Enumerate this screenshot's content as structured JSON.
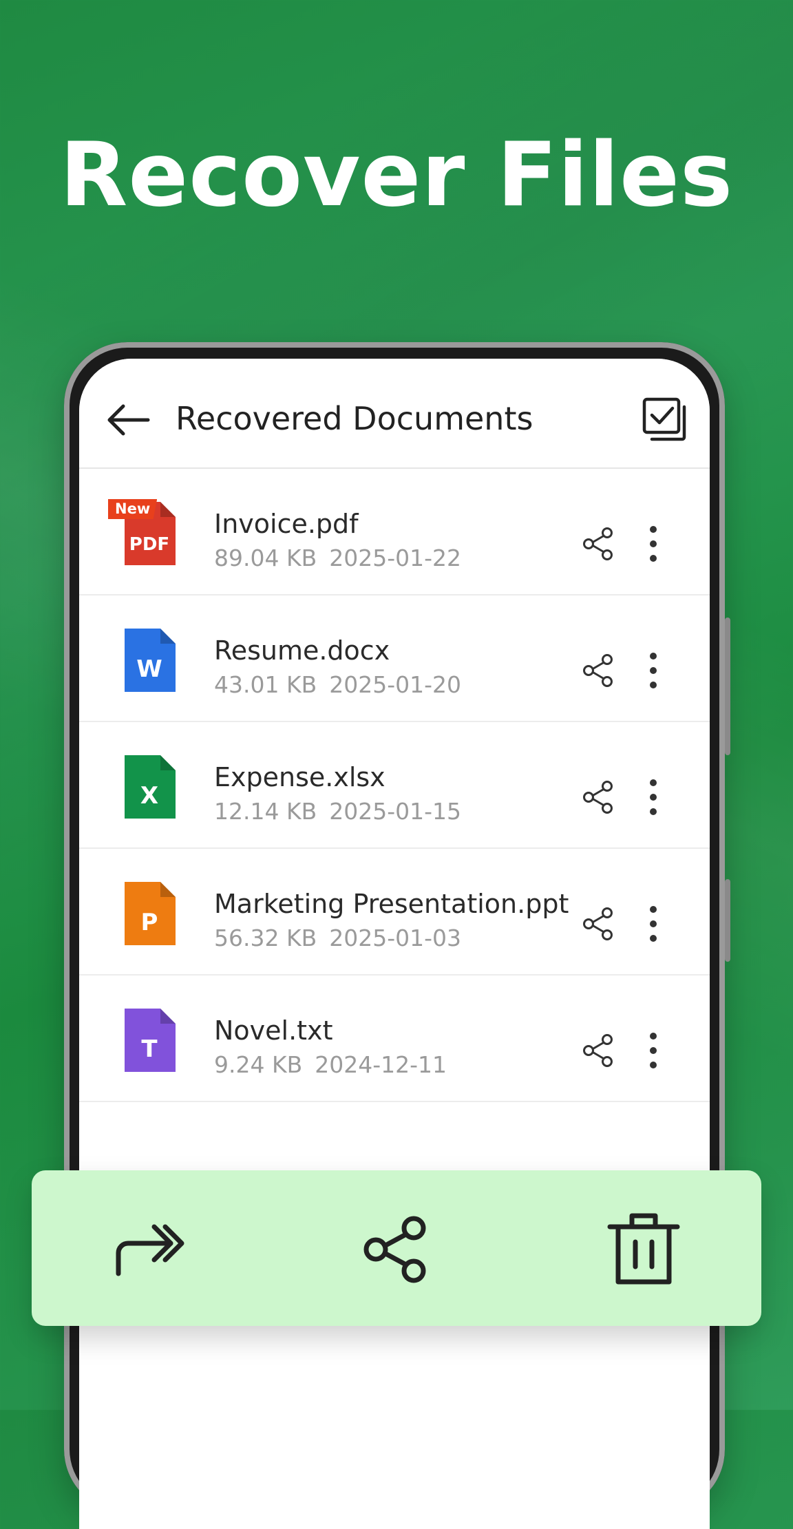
{
  "headline": "Recover Files",
  "app": {
    "title": "Recovered Documents",
    "back_icon": "arrow-left-icon",
    "select_icon": "select-all-icon"
  },
  "files": [
    {
      "name": "Invoice.pdf",
      "size": "89.04 KB",
      "date": "2025-01-22",
      "type": "PDF",
      "badge": "New",
      "color": "#d93a2b",
      "icon": "pdf-file-icon"
    },
    {
      "name": "Resume.docx",
      "size": "43.01 KB",
      "date": "2025-01-20",
      "type": "W",
      "color": "#2a72e3",
      "icon": "word-file-icon"
    },
    {
      "name": "Expense.xlsx",
      "size": "12.14 KB",
      "date": "2025-01-15",
      "type": "X",
      "color": "#12934a",
      "icon": "excel-file-icon"
    },
    {
      "name": "Marketing Presentation.ppt",
      "size": "56.32 KB",
      "date": "2025-01-03",
      "type": "P",
      "color": "#ee7c11",
      "icon": "powerpoint-file-icon"
    },
    {
      "name": "Novel.txt",
      "size": "9.24 KB",
      "date": "2024-12-11",
      "type": "T",
      "color": "#8152db",
      "icon": "text-file-icon"
    }
  ],
  "row_icons": {
    "share": "share-icon",
    "more": "more-vertical-icon"
  },
  "action_bar": {
    "background": "#cdf7cd",
    "items": [
      {
        "icon": "move-forward-icon"
      },
      {
        "icon": "share-icon"
      },
      {
        "icon": "trash-icon"
      }
    ]
  },
  "colors": {
    "brand_green": "#1f8a42",
    "badge_red": "#e8401c"
  }
}
